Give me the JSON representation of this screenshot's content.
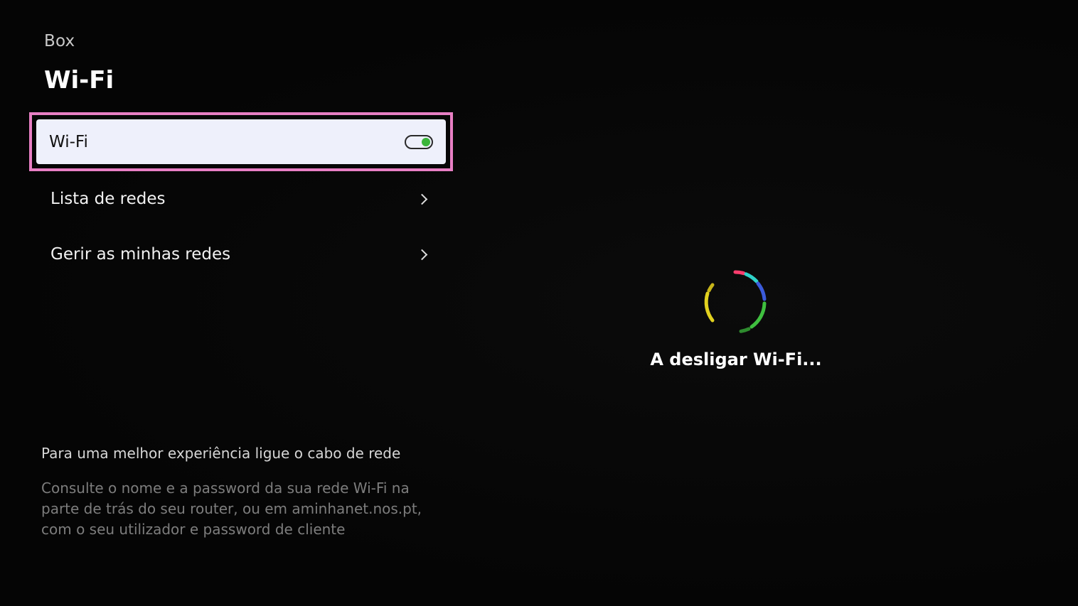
{
  "header": {
    "breadcrumb": "Box",
    "title": "Wi-Fi"
  },
  "menu": {
    "items": [
      {
        "label": "Wi-Fi",
        "type": "toggle",
        "toggle_on": true,
        "focused": true
      },
      {
        "label": "Lista de redes",
        "type": "link",
        "icon": "chevron-right-icon"
      },
      {
        "label": "Gerir as minhas redes",
        "type": "link",
        "icon": "chevron-right-icon"
      }
    ]
  },
  "hint": {
    "title": "Para uma melhor experiência ligue o cabo de rede",
    "body": "Consulte o nome e a password da sua rede Wi-Fi na parte de trás do seu router, ou em aminhanet.nos.pt, com o seu utilizador e password de cliente"
  },
  "status": {
    "icon": "loading-spinner-icon",
    "message": "A desligar Wi-Fi..."
  },
  "colors": {
    "focus_border": "#e87fc4",
    "focused_bg": "#eef0fb",
    "toggle_on": "#3ab53a",
    "background": "#050505"
  }
}
